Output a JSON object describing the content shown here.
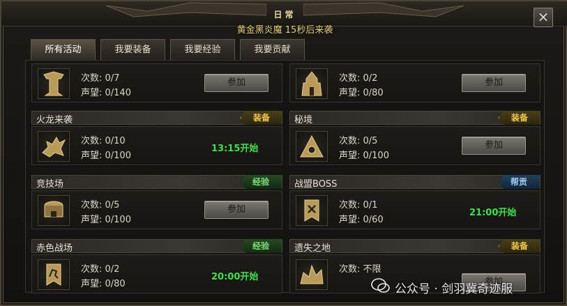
{
  "window": {
    "title": "日常",
    "subtitle": "黄金黑炎魔 15秒后来袭",
    "close_label": "×"
  },
  "tabs": [
    {
      "label": "所有活动",
      "active": true
    },
    {
      "label": "我要装备",
      "active": false
    },
    {
      "label": "我要经验",
      "active": false
    },
    {
      "label": "我要贡献",
      "active": false
    }
  ],
  "activities": [
    {
      "name": "",
      "badge": "",
      "count": "次数: 0/7",
      "rep": "声望: 0/140",
      "action": "参加",
      "icon": "pillar-icon"
    },
    {
      "name": "",
      "badge": "",
      "count": "次数: 0/2",
      "rep": "声望: 0/80",
      "action": "参加",
      "icon": "castle-icon"
    },
    {
      "name": "火龙来袭",
      "badge": "装备",
      "count": "次数: 0/10",
      "rep": "声望: 0/100",
      "start": "13:15开始",
      "icon": "dragon-icon"
    },
    {
      "name": "秘境",
      "badge": "装备",
      "count": "次数: 0/5",
      "rep": "声望: 0/100",
      "action": "参加",
      "icon": "mountain-icon"
    },
    {
      "name": "竞技场",
      "badge": "经验",
      "count": "次数: 0/5",
      "rep": "声望: 0/100",
      "action": "参加",
      "icon": "arena-icon"
    },
    {
      "name": "战盟BOSS",
      "badge": "帮贡",
      "count": "次数: 0/1",
      "rep": "声望: 0/60",
      "start": "21:00开始",
      "icon": "banner-icon"
    },
    {
      "name": "赤色战场",
      "badge": "经验",
      "count": "次数: 0/2",
      "rep": "声望: 0/80",
      "start": "20:00开始",
      "icon": "dragon-banner-icon"
    },
    {
      "name": "遗失之地",
      "badge": "装备",
      "count": "次数: 不限",
      "rep": "",
      "action": "参加",
      "icon": "ruins-icon"
    }
  ],
  "watermark": {
    "text": "公众号 · 剑羽冀奇迹服"
  },
  "colors": {
    "badge_equip": "#f0c84a",
    "badge_exp": "#7ce07a",
    "badge_contrib": "#9cc8f0",
    "start_time": "#3fe04a"
  }
}
